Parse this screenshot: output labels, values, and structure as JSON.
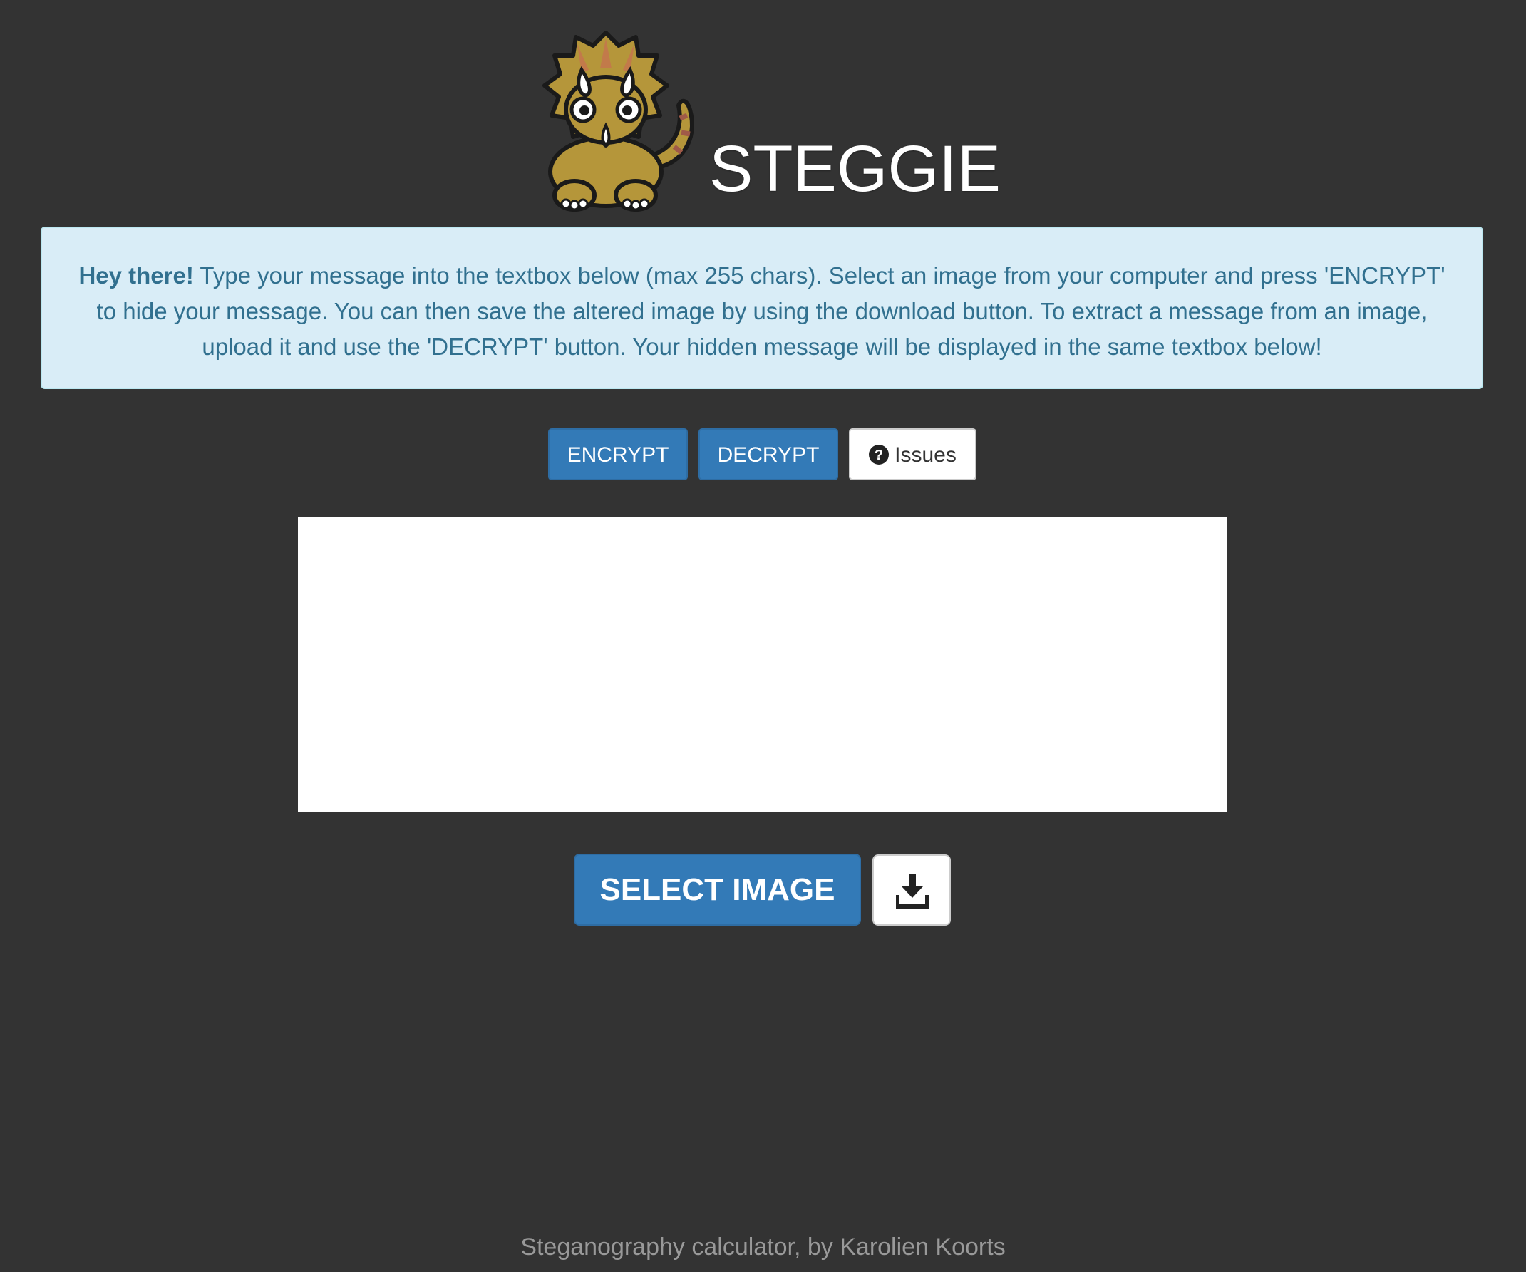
{
  "brand": {
    "title": "STEGGIE",
    "logo_icon": "triceratops-logo-icon",
    "logo_colors": {
      "body": "#b5963a",
      "frill": "#c27a4a",
      "stripe": "#a05a48"
    }
  },
  "alert": {
    "bold_text": "Hey there!",
    "text": " Type your message into the textbox below (max 255 chars). Select an image from your computer and press 'ENCRYPT' to hide your message. You can then save the altered image by using the download button. To extract a message from an image, upload it and use the 'DECRYPT' button. Your hidden message will be displayed in the same textbox below!"
  },
  "actions": {
    "encrypt_label": "ENCRYPT",
    "decrypt_label": "DECRYPT",
    "issues_label": "Issues",
    "issues_icon": "question-circle-icon"
  },
  "message": {
    "value": "",
    "placeholder": ""
  },
  "image": {
    "select_label": "SELECT IMAGE",
    "download_icon": "download-icon"
  },
  "footer": {
    "text": "Steganography calculator, by Karolien Koorts"
  },
  "colors": {
    "background": "#333333",
    "primary": "#337ab7",
    "alert_bg": "#d9edf7",
    "alert_text": "#31708f"
  }
}
